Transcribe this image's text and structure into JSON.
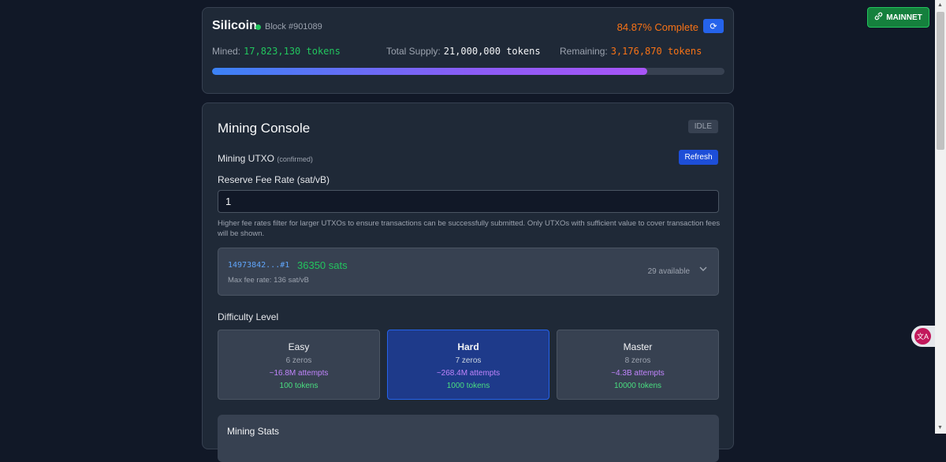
{
  "header": {
    "brand": "Silicoin",
    "block": "Block #901089",
    "complete": "84.87% Complete",
    "mined_label": "Mined:",
    "mined_value": "17,823,130 tokens",
    "supply_label": "Total Supply:",
    "supply_value": "21,000,000 tokens",
    "remaining_label": "Remaining:",
    "remaining_value": "3,176,870 tokens",
    "progress_fraction": 0.8487
  },
  "console": {
    "title": "Mining Console",
    "status": "IDLE",
    "utxo_label": "Mining UTXO",
    "utxo_sub": "(confirmed)",
    "refresh_label": "Refresh",
    "fee_label": "Reserve Fee Rate (sat/vB)",
    "fee_value": "1",
    "hint": "Higher fee rates filter for larger UTXOs to ensure transactions can be successfully submitted. Only UTXOs with sufficient value to cover transaction fees will be shown.",
    "utxo": {
      "txid": "14973842...#1",
      "sats": "36350 sats",
      "max_fee": "Max fee rate: 136 sat/vB",
      "available": "29 available"
    },
    "difficulty_label": "Difficulty Level",
    "difficulties": [
      {
        "name": "Easy",
        "zeros": "6 zeros",
        "attempts": "~16.8M attempts",
        "tokens": "100 tokens"
      },
      {
        "name": "Hard",
        "zeros": "7 zeros",
        "attempts": "~268.4M attempts",
        "tokens": "1000 tokens"
      },
      {
        "name": "Master",
        "zeros": "8 zeros",
        "attempts": "~4.3B attempts",
        "tokens": "10000 tokens"
      }
    ],
    "selected_difficulty": "Hard",
    "stats_title": "Mining Stats"
  },
  "network": {
    "label": "MAINNET",
    "icon": "link-icon"
  },
  "icons": {
    "refresh": "refresh-icon",
    "chevron": "chevron-down-icon",
    "translate": "translate-icon"
  },
  "colors": {
    "accent": "#2563eb",
    "success": "#22c55e",
    "warning": "#f97316"
  }
}
